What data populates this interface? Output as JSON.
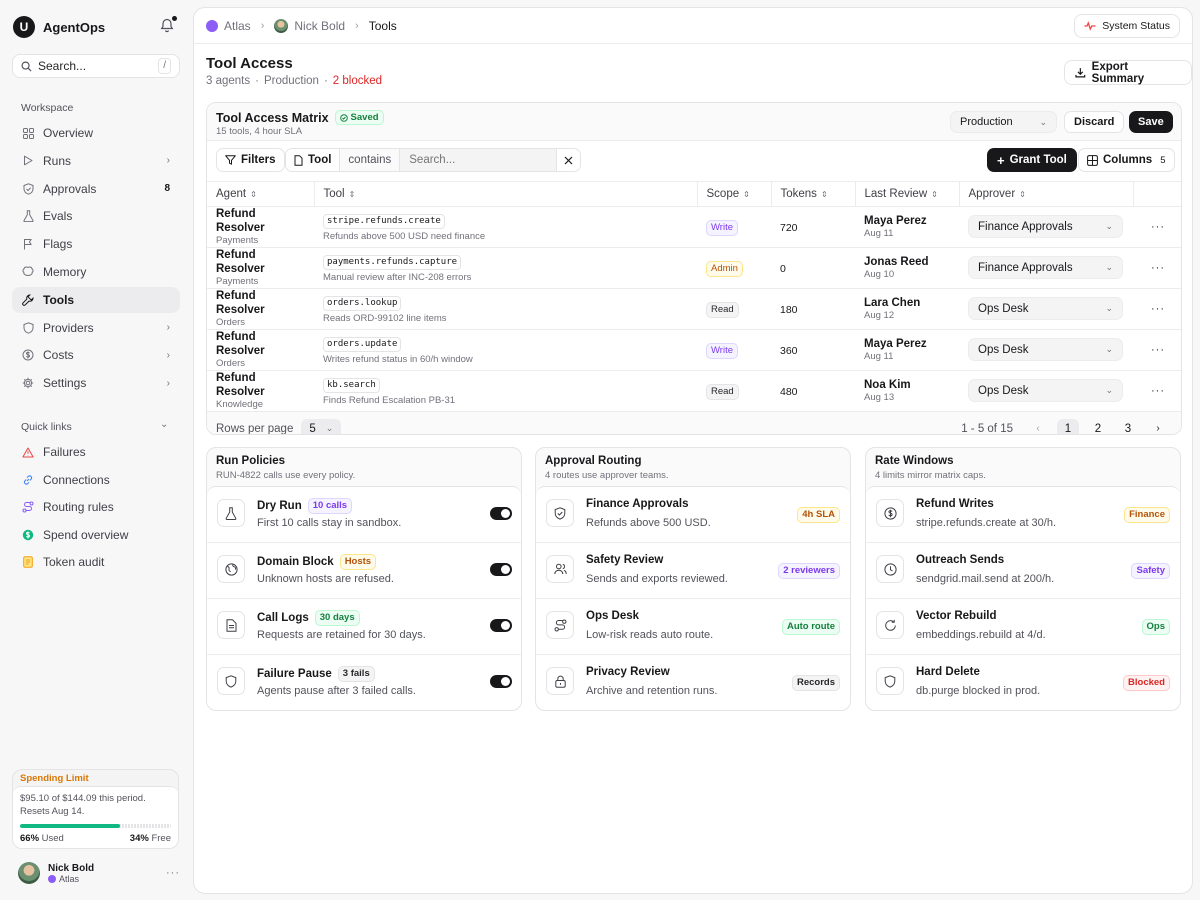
{
  "brand": {
    "name": "AgentOps",
    "logo_letter": "U"
  },
  "search": {
    "placeholder": "Search...",
    "shortcut": "/"
  },
  "sidebar": {
    "workspace_label": "Workspace",
    "items": [
      {
        "label": "Overview",
        "icon": "grid-icon",
        "chevron": false
      },
      {
        "label": "Runs",
        "icon": "play-icon",
        "chevron": true
      },
      {
        "label": "Approvals",
        "icon": "shield-check-icon",
        "count": "8"
      },
      {
        "label": "Evals",
        "icon": "flask-icon"
      },
      {
        "label": "Flags",
        "icon": "flag-icon"
      },
      {
        "label": "Memory",
        "icon": "brain-icon"
      },
      {
        "label": "Tools",
        "icon": "wrench-icon",
        "active": true
      },
      {
        "label": "Providers",
        "icon": "shield-icon",
        "chevron": true
      },
      {
        "label": "Costs",
        "icon": "dollar-icon",
        "chevron": true
      },
      {
        "label": "Settings",
        "icon": "gear-icon",
        "chevron": true
      }
    ],
    "quick_links_label": "Quick links",
    "quick_links": [
      {
        "label": "Failures",
        "icon": "warning-icon",
        "color": "#ef4444"
      },
      {
        "label": "Connections",
        "icon": "link-icon",
        "color": "#3b82f6"
      },
      {
        "label": "Routing rules",
        "icon": "route-icon",
        "color": "#8b5cf6"
      },
      {
        "label": "Spend overview",
        "icon": "dollar-circle-icon",
        "color": "#10b981"
      },
      {
        "label": "Token audit",
        "icon": "document-icon",
        "color": "#f59e0b"
      }
    ]
  },
  "spending": {
    "title": "Spending Limit",
    "text": "$95.10 of $144.09 this period.",
    "reset": "Resets Aug 14.",
    "used_pct": 66,
    "used_label": "66%",
    "used_word": "Used",
    "free_label": "34%",
    "free_word": "Free",
    "accent": "#10b981"
  },
  "user": {
    "name": "Nick Bold",
    "org": "Atlas"
  },
  "breadcrumb": [
    "Atlas",
    "Nick Bold",
    "Tools"
  ],
  "system_status": "System Status",
  "page": {
    "title": "Tool Access",
    "agents": "3 agents",
    "env": "Production",
    "blocked": "2 blocked",
    "export": "Export Summary"
  },
  "matrix": {
    "title": "Tool Access Matrix",
    "saved": "Saved",
    "subtitle": "15 tools, 4 hour SLA",
    "env_select": "Production",
    "discard": "Discard",
    "save": "Save",
    "filters": "Filters",
    "filter_field": "Tool",
    "filter_op": "contains",
    "filter_placeholder": "Search...",
    "grant": "Grant Tool",
    "columns": "Columns",
    "columns_count": "5",
    "headers": [
      "Agent",
      "Tool",
      "Scope",
      "Tokens",
      "Last Review",
      "Approver"
    ],
    "rows": [
      {
        "agent": "Refund Resolver",
        "cat": "Payments",
        "tool": "stripe.refunds.create",
        "desc": "Refunds above 500 USD need finance",
        "scope": "Write",
        "scope_cls": "write",
        "tokens": "720",
        "reviewer": "Maya Perez",
        "date": "Aug 11",
        "approver": "Finance Approvals"
      },
      {
        "agent": "Refund Resolver",
        "cat": "Payments",
        "tool": "payments.refunds.capture",
        "desc": "Manual review after INC-208 errors",
        "scope": "Admin",
        "scope_cls": "admin",
        "tokens": "0",
        "reviewer": "Jonas Reed",
        "date": "Aug 10",
        "approver": "Finance Approvals"
      },
      {
        "agent": "Refund Resolver",
        "cat": "Orders",
        "tool": "orders.lookup",
        "desc": "Reads ORD-99102 line items",
        "scope": "Read",
        "scope_cls": "read",
        "tokens": "180",
        "reviewer": "Lara Chen",
        "date": "Aug 12",
        "approver": "Ops Desk"
      },
      {
        "agent": "Refund Resolver",
        "cat": "Orders",
        "tool": "orders.update",
        "desc": "Writes refund status in 60/h window",
        "scope": "Write",
        "scope_cls": "write",
        "tokens": "360",
        "reviewer": "Maya Perez",
        "date": "Aug 11",
        "approver": "Ops Desk"
      },
      {
        "agent": "Refund Resolver",
        "cat": "Knowledge",
        "tool": "kb.search",
        "desc": "Finds Refund Escalation PB-31",
        "scope": "Read",
        "scope_cls": "read",
        "tokens": "480",
        "reviewer": "Noa Kim",
        "date": "Aug 13",
        "approver": "Ops Desk"
      }
    ],
    "rows_per_page_label": "Rows per page",
    "rows_per_page": "5",
    "range": "1 - 5 of 15",
    "pages": [
      "1",
      "2",
      "3"
    ]
  },
  "cards": [
    {
      "title": "Run Policies",
      "subtitle": "RUN-4822 calls use every policy.",
      "rows": [
        {
          "title": "Dry Run",
          "tag": "10 calls",
          "tag_cls": "purple",
          "desc": "First 10 calls stay in sandbox.",
          "icon": "flask-icon",
          "toggle": true
        },
        {
          "title": "Domain Block",
          "tag": "Hosts",
          "tag_cls": "amber",
          "desc": "Unknown hosts are refused.",
          "icon": "globe-icon",
          "toggle": true
        },
        {
          "title": "Call Logs",
          "tag": "30 days",
          "tag_cls": "green",
          "desc": "Requests are retained for 30 days.",
          "icon": "document-icon",
          "toggle": true
        },
        {
          "title": "Failure Pause",
          "tag": "3 fails",
          "tag_cls": "gray",
          "desc": "Agents pause after 3 failed calls.",
          "icon": "shield-icon",
          "toggle": true
        }
      ]
    },
    {
      "title": "Approval Routing",
      "subtitle": "4 routes use approver teams.",
      "rows": [
        {
          "title": "Finance Approvals",
          "desc": "Refunds above 500 USD.",
          "tag": "4h SLA",
          "tag_cls": "amber",
          "icon": "shield-check-icon"
        },
        {
          "title": "Safety Review",
          "desc": "Sends and exports reviewed.",
          "tag": "2 reviewers",
          "tag_cls": "purple",
          "icon": "users-icon"
        },
        {
          "title": "Ops Desk",
          "desc": "Low-risk reads auto route.",
          "tag": "Auto route",
          "tag_cls": "green",
          "icon": "route-icon"
        },
        {
          "title": "Privacy Review",
          "desc": "Archive and retention runs.",
          "tag": "Records",
          "tag_cls": "gray",
          "icon": "lock-icon"
        }
      ]
    },
    {
      "title": "Rate Windows",
      "subtitle": "4 limits mirror matrix caps.",
      "rows": [
        {
          "title": "Refund Writes",
          "desc": "stripe.refunds.create at 30/h.",
          "tag": "Finance",
          "tag_cls": "amber",
          "icon": "dollar-circle-icon"
        },
        {
          "title": "Outreach Sends",
          "desc": "sendgrid.mail.send at 200/h.",
          "tag": "Safety",
          "tag_cls": "purple",
          "icon": "clock-icon"
        },
        {
          "title": "Vector Rebuild",
          "desc": "embeddings.rebuild at 4/d.",
          "tag": "Ops",
          "tag_cls": "green",
          "icon": "refresh-icon"
        },
        {
          "title": "Hard Delete",
          "desc": "db.purge blocked in prod.",
          "tag": "Blocked",
          "tag_cls": "red",
          "icon": "shield-icon"
        }
      ]
    }
  ]
}
